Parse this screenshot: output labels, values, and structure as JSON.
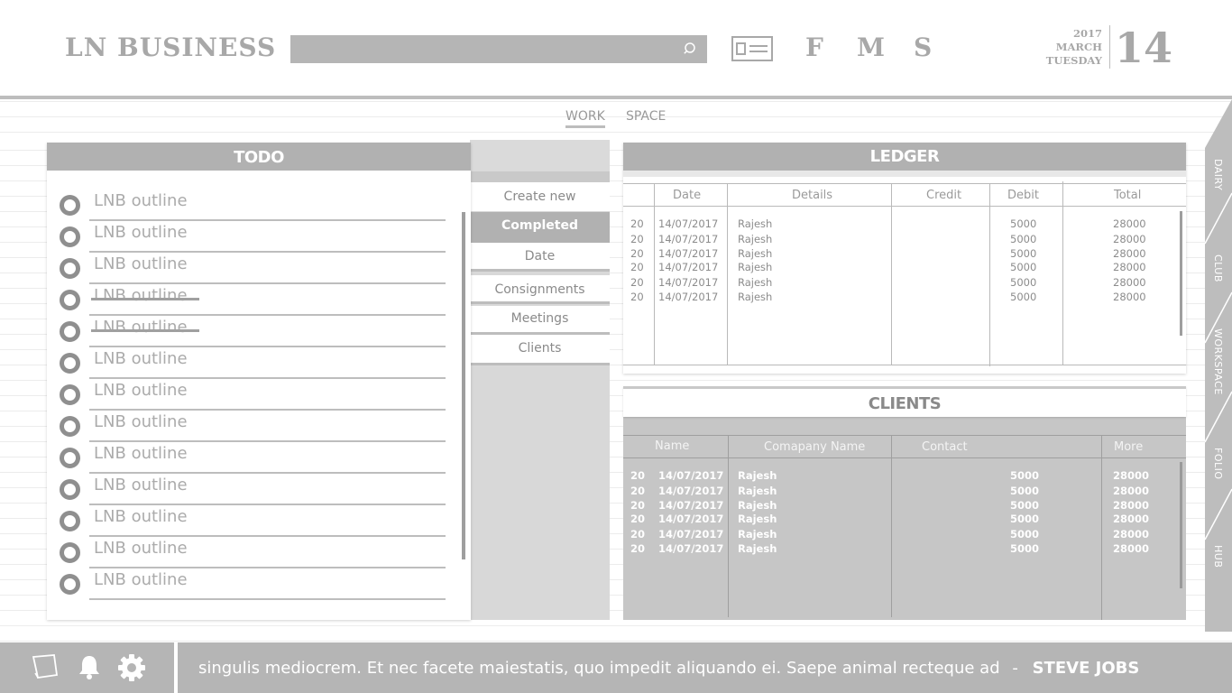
{
  "header": {
    "logo": "LN BUSINESS",
    "search_placeholder": "",
    "shortcuts": [
      "F",
      "M",
      "S"
    ],
    "date": {
      "year": "2017",
      "month": "MARCH",
      "weekday": "TUESDAY",
      "day": "14"
    }
  },
  "workspace_tabs": [
    "WORK",
    "SPACE"
  ],
  "todo": {
    "title": "TODO",
    "items": [
      {
        "text": "LNB outline",
        "done": false
      },
      {
        "text": "LNB outline",
        "done": false
      },
      {
        "text": "LNB outline",
        "done": false
      },
      {
        "text": "LNB outline",
        "done": true
      },
      {
        "text": "LNB outline",
        "done": true
      },
      {
        "text": "LNB outline",
        "done": false
      },
      {
        "text": "LNB outline",
        "done": false
      },
      {
        "text": "LNB outline",
        "done": false
      },
      {
        "text": "LNB outline",
        "done": false
      },
      {
        "text": "LNB outline",
        "done": false
      },
      {
        "text": "LNB outline",
        "done": false
      },
      {
        "text": "LNB outline",
        "done": false
      },
      {
        "text": "LNB outline",
        "done": false
      }
    ]
  },
  "filters": {
    "create_new": "Create new",
    "completed": "Completed",
    "date": "Date",
    "consignments": "Consignments",
    "meetings": "Meetings",
    "clients": "Clients"
  },
  "ledger": {
    "title": "LEDGER",
    "columns": [
      "",
      "Date",
      "Details",
      "Credit",
      "Debit",
      "Total"
    ],
    "rows": [
      [
        "20",
        "14/07/2017",
        "Rajesh",
        "",
        "5000",
        "28000"
      ],
      [
        "20",
        "14/07/2017",
        "Rajesh",
        "",
        "5000",
        "28000"
      ],
      [
        "20",
        "14/07/2017",
        "Rajesh",
        "",
        "5000",
        "28000"
      ],
      [
        "20",
        "14/07/2017",
        "Rajesh",
        "",
        "5000",
        "28000"
      ],
      [
        "20",
        "14/07/2017",
        "Rajesh",
        "",
        "5000",
        "28000"
      ],
      [
        "20",
        "14/07/2017",
        "Rajesh",
        "",
        "5000",
        "28000"
      ]
    ]
  },
  "clients": {
    "title": "CLIENTS",
    "columns": [
      "Name",
      "Comapany Name",
      "Contact",
      "More"
    ],
    "rows": [
      [
        "20",
        "14/07/2017",
        "Rajesh",
        "5000",
        "28000"
      ],
      [
        "20",
        "14/07/2017",
        "Rajesh",
        "5000",
        "28000"
      ],
      [
        "20",
        "14/07/2017",
        "Rajesh",
        "5000",
        "28000"
      ],
      [
        "20",
        "14/07/2017",
        "Rajesh",
        "5000",
        "28000"
      ],
      [
        "20",
        "14/07/2017",
        "Rajesh",
        "5000",
        "28000"
      ],
      [
        "20",
        "14/07/2017",
        "Rajesh",
        "5000",
        "28000"
      ]
    ]
  },
  "rail": [
    "DAIRY",
    "CLUB",
    "WORKSPACE",
    "FOLIO",
    "HUB"
  ],
  "footer": {
    "quote": "singulis mediocrem. Et nec facete maiestatis, quo impedit aliquando ei. Saepe animal recteque ad",
    "separator": "-",
    "author": "STEVE JOBS"
  },
  "icons": [
    "search-icon",
    "id-card-icon",
    "notes-icon",
    "bell-icon",
    "gear-icon"
  ],
  "colors": {
    "panel_header": "#b1b1b1",
    "footer": "#b5b5b5",
    "filter_bg": "#d8d8d8"
  }
}
